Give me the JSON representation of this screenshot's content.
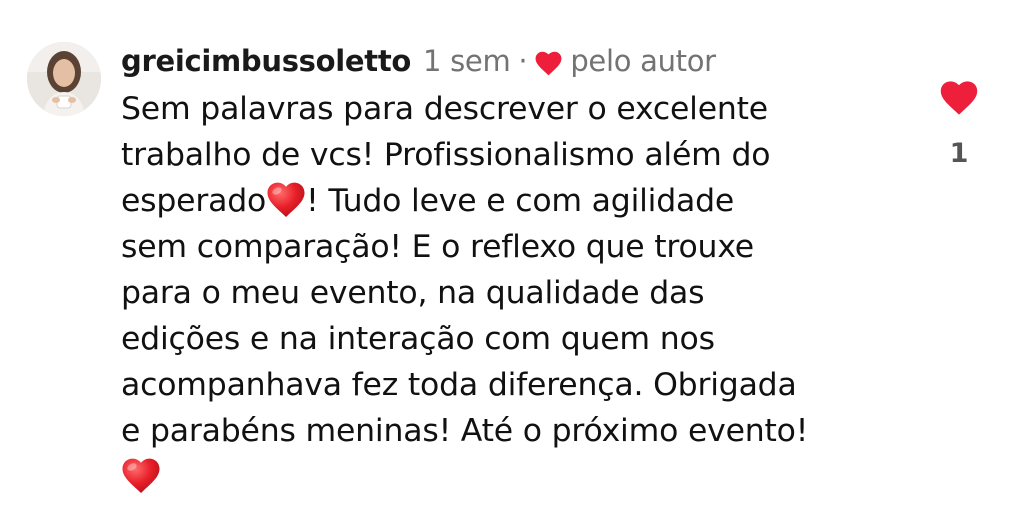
{
  "comment": {
    "username": "greicimbussoletto",
    "time": "1 sem",
    "separator": "·",
    "liked_by_author": "pelo autor",
    "text_lines": [
      "Sem palavras para descrever o excelente",
      "trabalho de vcs! Profissionalismo além do",
      "esperado",
      "! Tudo leve e com agilidade",
      "sem comparação! E o reflexo que trouxe",
      "para o meu evento, na qualidade das",
      "edições e na interação com quem nos",
      "acompanhava fez toda diferença. Obrigada",
      "e parabéns meninas! Até o próximo evento!"
    ],
    "emoji": "red-heart-emoji",
    "like_count": "1"
  },
  "colors": {
    "heart": "#ed1f3a",
    "meta_text": "#737373",
    "body_text": "#111111"
  },
  "icons": {
    "author_like": "heart-icon",
    "like_button": "heart-icon"
  }
}
